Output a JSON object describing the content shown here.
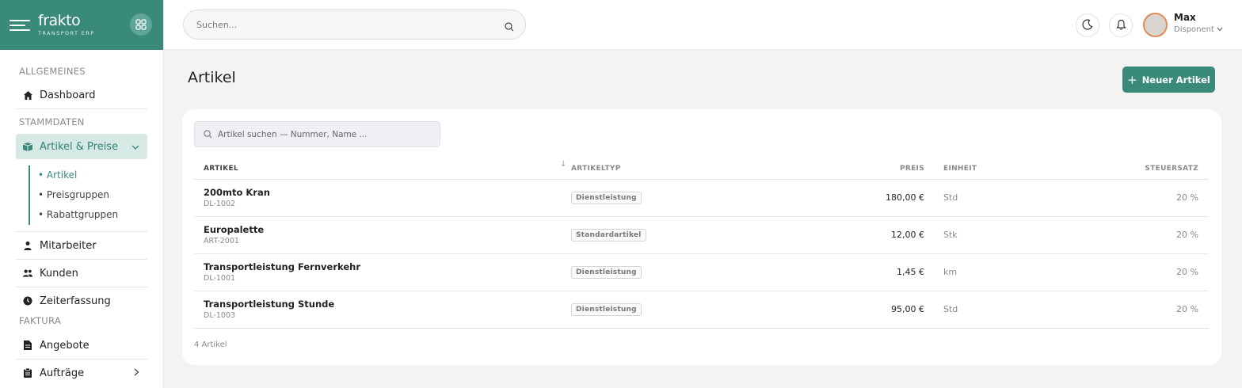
{
  "brand": {
    "name": "frakto",
    "sub": "TRANSPORT ERP"
  },
  "sidebar": {
    "sections": {
      "general": "ALLGEMEINES",
      "master": "STAMMDATEN",
      "billing": "FAKTURA"
    },
    "items": {
      "dashboard": "Dashboard",
      "articles_prices": "Artikel & Preise",
      "employees": "Mitarbeiter",
      "customers": "Kunden",
      "time": "Zeiterfassung",
      "offers": "Angebote",
      "orders": "Aufträge"
    },
    "subitems": [
      "Artikel",
      "Preisgruppen",
      "Rabattgruppen"
    ]
  },
  "header": {
    "search_placeholder": "Suchen...",
    "user_name": "Max",
    "user_role": "Disponent"
  },
  "page": {
    "title": "Artikel",
    "new_button": "Neuer Artikel",
    "table_search_placeholder": "Artikel suchen — Nummer, Name ...",
    "count": "4 Artikel"
  },
  "table": {
    "columns": [
      "ARTIKEL",
      "ARTIKELTYP",
      "PREIS",
      "EINHEIT",
      "STEUERSATZ"
    ],
    "rows": [
      {
        "name": "200mto Kran",
        "number": "DL-1002",
        "type": "Dienstleistung",
        "price": "180,00 €",
        "unit": "Std",
        "tax": "20 %"
      },
      {
        "name": "Europalette",
        "number": "ART-2001",
        "type": "Standardartikel",
        "price": "12,00 €",
        "unit": "Stk",
        "tax": "20 %"
      },
      {
        "name": "Transportleistung Fernverkehr",
        "number": "DL-1001",
        "type": "Dienstleistung",
        "price": "1,45 €",
        "unit": "km",
        "tax": "20 %"
      },
      {
        "name": "Transportleistung Stunde",
        "number": "DL-1003",
        "type": "Dienstleistung",
        "price": "95,00 €",
        "unit": "Std",
        "tax": "20 %"
      }
    ]
  },
  "colors": {
    "accent": "#3a8a7c",
    "accent_light": "#d7e9e5",
    "background": "#f4f3f1"
  },
  "icons": [
    "menu-icon",
    "apps-grid-icon",
    "home-icon",
    "box-icon",
    "chevron-down-icon",
    "user-icon",
    "users-icon",
    "clock-icon",
    "document-icon",
    "clipboard-icon",
    "chevron-right-icon",
    "search-icon",
    "moon-icon",
    "bell-icon",
    "plus-icon",
    "sort-arrow-icon"
  ]
}
